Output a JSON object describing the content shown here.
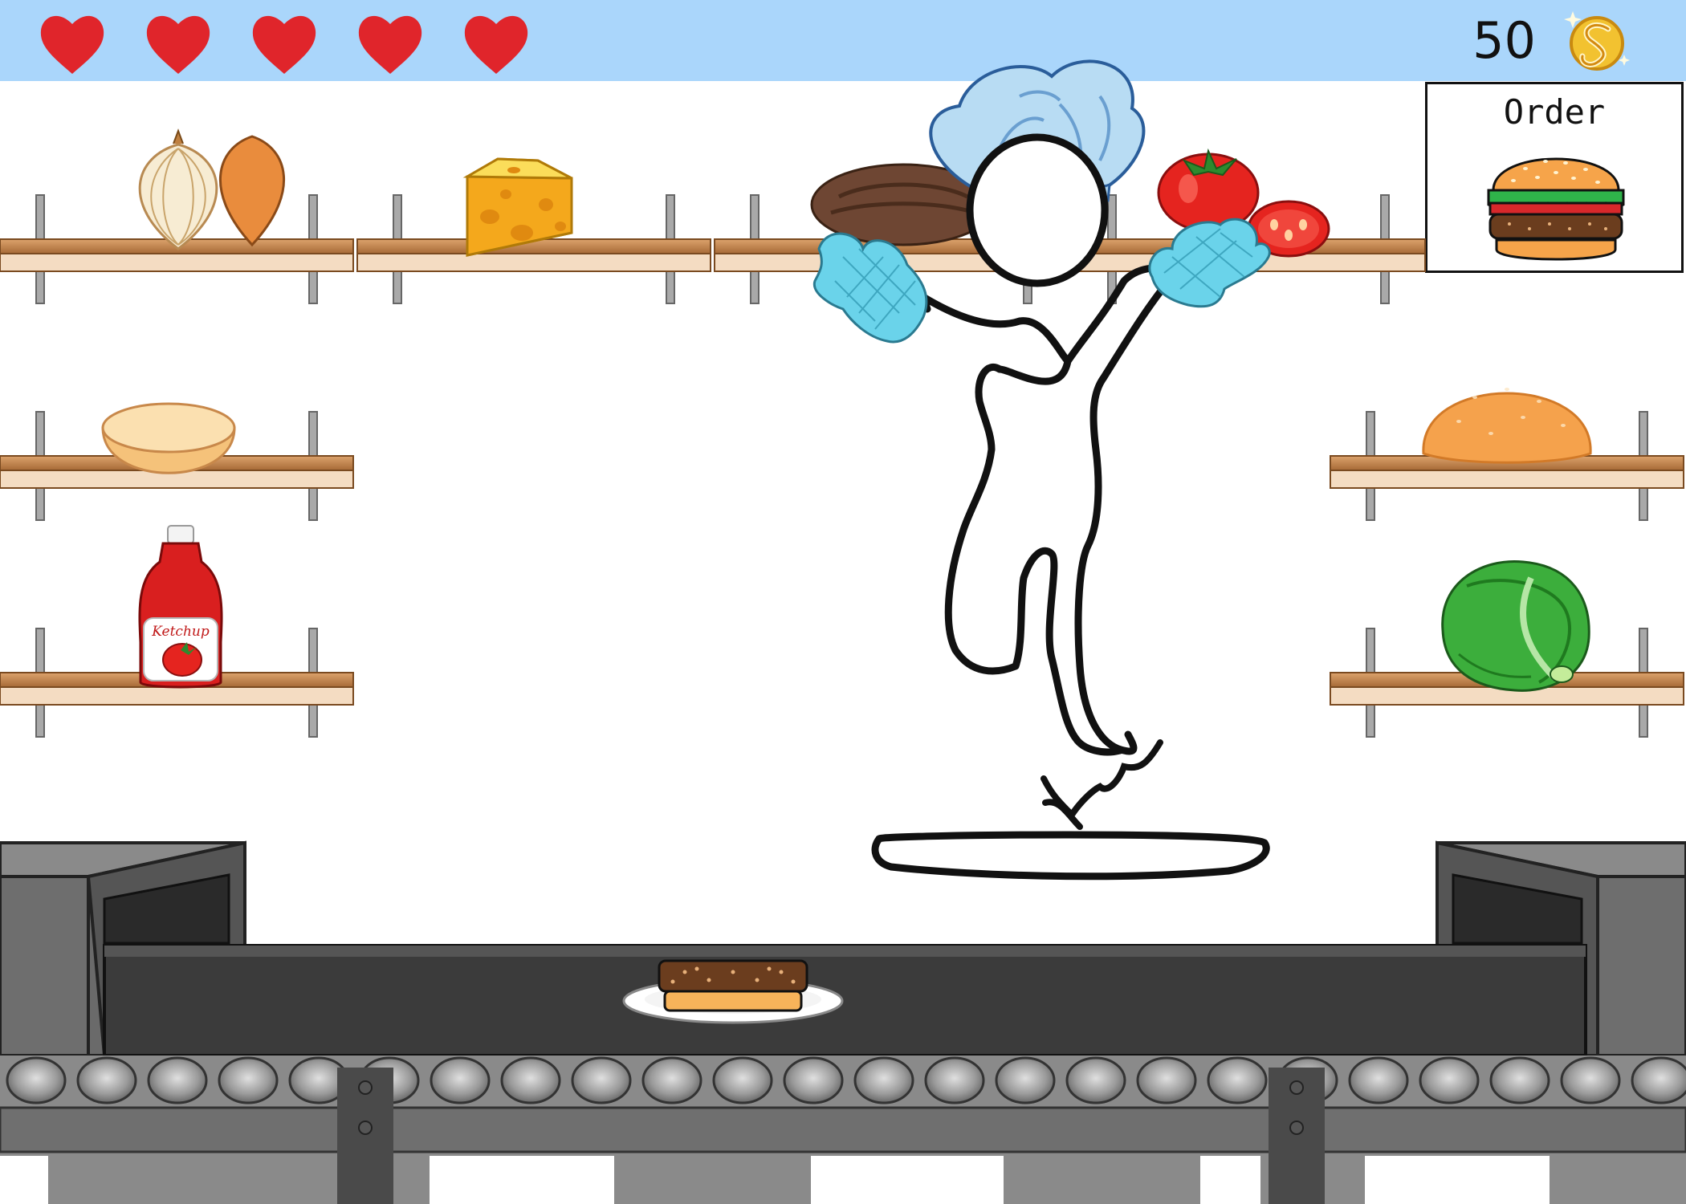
{
  "hud": {
    "lives": 5,
    "score": "50",
    "currency_icon": "coin-icon"
  },
  "order": {
    "title": "Order",
    "layers": [
      "bun-top",
      "lettuce",
      "ketchup",
      "patty",
      "bun-bottom"
    ]
  },
  "shelves": {
    "onion": "onion-icon",
    "cheese": "cheese-icon",
    "patty": "patty-icon",
    "tomato": "tomato-icon",
    "bottom_bun": "bottom-bun-icon",
    "top_bun": "top-bun-icon",
    "ketchup": "ketchup-icon",
    "ketchup_label": "Ketchup",
    "lettuce": "lettuce-icon"
  },
  "plate": {
    "stack": [
      "bun-bottom",
      "patty"
    ]
  },
  "colors": {
    "sky": "#aad6fb",
    "heart": "#e0252b",
    "shelf": "#c98b52",
    "belt": "#3b3b3b"
  }
}
